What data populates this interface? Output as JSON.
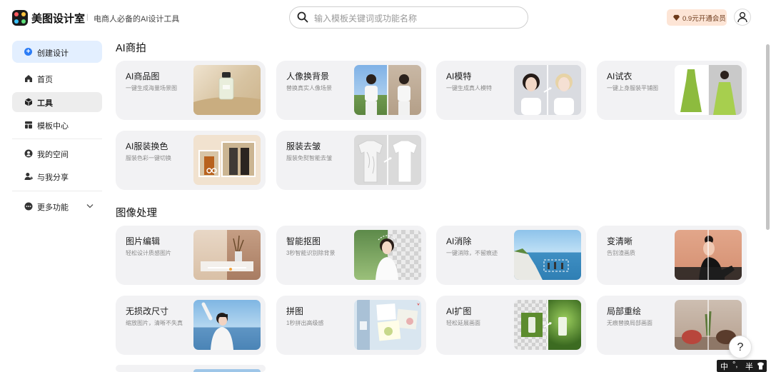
{
  "brand": {
    "name": "美图设计室",
    "slogan": "电商人必备的AI设计工具"
  },
  "search": {
    "placeholder": "输入模板关键词或功能名称"
  },
  "header": {
    "vip_label": "0.9元开通会员"
  },
  "sidebar": {
    "create_label": "创建设计",
    "items": [
      {
        "label": "首页",
        "icon": "home-icon"
      },
      {
        "label": "工具",
        "icon": "box-icon",
        "active": true
      },
      {
        "label": "模板中心",
        "icon": "layout-icon"
      },
      {
        "label": "我的空间",
        "icon": "user-circle-icon"
      },
      {
        "label": "与我分享",
        "icon": "user-add-icon"
      },
      {
        "label": "更多功能",
        "icon": "more-icon"
      }
    ]
  },
  "sections": [
    {
      "title": "AI商拍",
      "cards": [
        {
          "title": "AI商品图",
          "desc": "一键生成海量场景图"
        },
        {
          "title": "人像换背景",
          "desc": "替换真实人像场景"
        },
        {
          "title": "AI模特",
          "desc": "一键生成真人模特"
        },
        {
          "title": "AI试衣",
          "desc": "一键上身服装平铺图"
        },
        {
          "title": "AI服装换色",
          "desc": "服装色彩一键切换"
        },
        {
          "title": "服装去皱",
          "desc": "服装免熨智能去皱"
        }
      ]
    },
    {
      "title": "图像处理",
      "cards": [
        {
          "title": "图片编辑",
          "desc": "轻松设计质感图片"
        },
        {
          "title": "智能抠图",
          "desc": "3秒智能识别除背景"
        },
        {
          "title": "AI消除",
          "desc": "一键消除，不留痕迹"
        },
        {
          "title": "变清晰",
          "desc": "告别渣画质"
        },
        {
          "title": "无损改尺寸",
          "desc": "缩放图片，清晰不失真"
        },
        {
          "title": "拼图",
          "desc": "1秒拼出高级感"
        },
        {
          "title": "AI扩图",
          "desc": "轻松延展画面"
        },
        {
          "title": "局部重绘",
          "desc": "无痕替换局部画面"
        }
      ]
    }
  ],
  "help": {
    "label": "?"
  },
  "ime": {
    "lang": "中",
    "punct": "°,",
    "width": "半"
  },
  "colors": {
    "accent": "#2d7df6",
    "vip_bg": "#fde5d6",
    "card_bg": "#f2f2f4",
    "active_nav": "#ededed"
  }
}
